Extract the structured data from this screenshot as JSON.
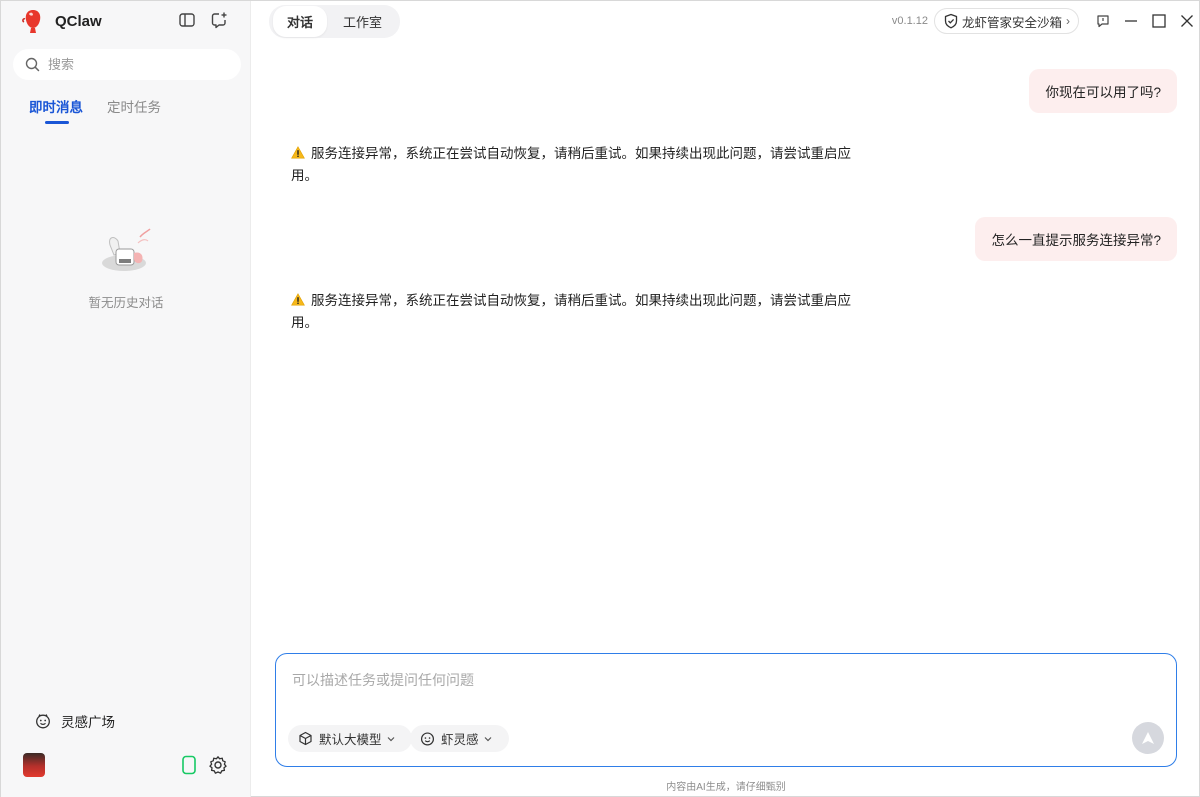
{
  "app": {
    "name": "QClaw",
    "version": "v0.1.12"
  },
  "sidebar": {
    "search_placeholder": "搜索",
    "tabs": [
      {
        "label": "即时消息",
        "active": true
      },
      {
        "label": "定时任务",
        "active": false
      }
    ],
    "empty_text": "暂无历史对话",
    "inspiration_label": "灵感广场"
  },
  "header": {
    "tabs": [
      {
        "label": "对话",
        "active": true
      },
      {
        "label": "工作室",
        "active": false
      }
    ],
    "sandbox_label": "龙虾管家安全沙箱"
  },
  "messages": [
    {
      "role": "user",
      "text": "你现在可以用了吗?"
    },
    {
      "role": "assistant",
      "line1": "服务连接异常，系统正在尝试自动恢复，请稍后重试。如果持续出现此问题，请尝试重启应",
      "line2": "用。"
    },
    {
      "role": "user",
      "text": "怎么一直提示服务连接异常?"
    },
    {
      "role": "assistant",
      "line1": "服务连接异常，系统正在尝试自动恢复，请稍后重试。如果持续出现此问题，请尝试重启应",
      "line2": "用。"
    }
  ],
  "composer": {
    "placeholder": "可以描述任务或提问任何问题",
    "model_label": "默认大模型",
    "inspiration_chip_label": "虾灵感"
  },
  "footer": {
    "disclaimer": "内容由AI生成，请仔细甄别"
  },
  "colors": {
    "accent": "#1a56d6",
    "user_bubble": "#fdeeee",
    "composer_border": "#2f7ee8",
    "sidebar_bg": "#f7f7f8"
  }
}
